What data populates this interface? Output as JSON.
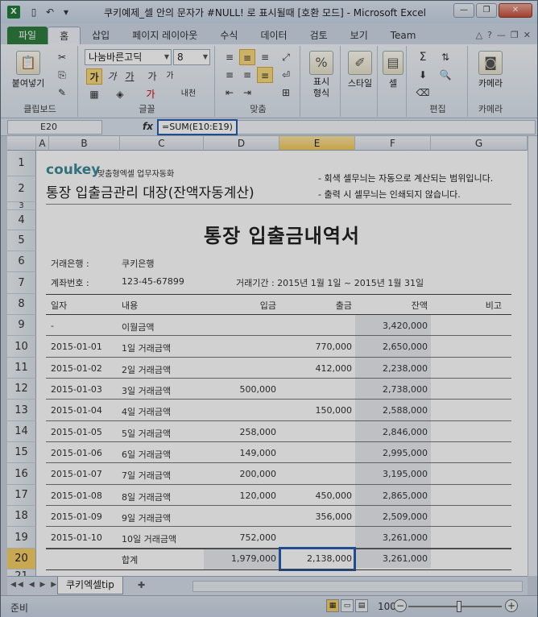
{
  "window": {
    "title": "쿠키예제_셀 안의 문자가 #NULL! 로 표시될때 [호환 모드] - Microsoft Excel",
    "app_icon": "X",
    "quick_access": [
      "save-icon",
      "undo-icon",
      "redo-icon"
    ],
    "buttons": [
      "minimize",
      "restore",
      "close"
    ],
    "button_glyphs": [
      "—",
      "❐",
      "✕"
    ]
  },
  "tabs": [
    "파일",
    "홈",
    "삽입",
    "페이지 레이아웃",
    "수식",
    "데이터",
    "검토",
    "보기",
    "Team"
  ],
  "ribbon": {
    "clipboard": {
      "paste": "붙여넣기",
      "label": "클립보드"
    },
    "font": {
      "name": "나눔바른고딕",
      "size": "8",
      "label": "글꼴",
      "bold": "가",
      "italic": "가",
      "underline": "가",
      "grow": "가",
      "shrink": "가",
      "phonetic": "내천"
    },
    "align": {
      "label": "맞춤"
    },
    "number": {
      "btn": "표시 형식",
      "symbol": "%"
    },
    "styles": {
      "btn": "스타일"
    },
    "cells": {
      "btn": "셀"
    },
    "edit": {
      "label": "편집",
      "sum": "Σ"
    },
    "camera": {
      "btn": "카메라",
      "label": "카메라"
    }
  },
  "formula_bar": {
    "name_box": "E20",
    "fx": "fx",
    "formula": "=SUM(E10:E19)"
  },
  "columns": [
    "A",
    "B",
    "C",
    "D",
    "E",
    "F",
    "G"
  ],
  "selected_column": "E",
  "rows": [
    "1",
    "2",
    "3",
    "4",
    "5",
    "6",
    "7",
    "8",
    "9",
    "10",
    "11",
    "12",
    "13",
    "14",
    "15",
    "16",
    "17",
    "18",
    "19",
    "20",
    "21"
  ],
  "selected_row": "20",
  "sheet": {
    "logo": "coukey",
    "logo_tagline": "맞춤형엑셀 업무자동화",
    "subtitle": "통장 입출금관리 대장(잔액자동계산)",
    "note1": "- 회색 셀무늬는 자동으로 계산되는 범위입니다.",
    "note2": "- 출력 시 셀무늬는 인쇄되지 않습니다.",
    "title": "통장 입출금내역서",
    "bank_label": "거래은행 :",
    "bank_value": "쿠키은행",
    "account_label": "계좌번호 :",
    "account_value": "123-45-67899",
    "period": "거래기간 : 2015년 1월 1일 ~ 2015년 1월 31일",
    "headers": [
      "일자",
      "내용",
      "입금",
      "출금",
      "잔액",
      "비고"
    ],
    "table_rows": [
      [
        "-",
        "이월금액",
        "",
        "",
        "3,420,000",
        ""
      ],
      [
        "2015-01-01",
        "1일 거래금액",
        "",
        "770,000",
        "2,650,000",
        ""
      ],
      [
        "2015-01-02",
        "2일 거래금액",
        "",
        "412,000",
        "2,238,000",
        ""
      ],
      [
        "2015-01-03",
        "3일 거래금액",
        "500,000",
        "",
        "2,738,000",
        ""
      ],
      [
        "2015-01-04",
        "4일 거래금액",
        "",
        "150,000",
        "2,588,000",
        ""
      ],
      [
        "2015-01-05",
        "5일 거래금액",
        "258,000",
        "",
        "2,846,000",
        ""
      ],
      [
        "2015-01-06",
        "6일 거래금액",
        "149,000",
        "",
        "2,995,000",
        ""
      ],
      [
        "2015-01-07",
        "7일 거래금액",
        "200,000",
        "",
        "3,195,000",
        ""
      ],
      [
        "2015-01-08",
        "8일 거래금액",
        "120,000",
        "450,000",
        "2,865,000",
        ""
      ],
      [
        "2015-01-09",
        "9일 거래금액",
        "",
        "356,000",
        "2,509,000",
        ""
      ],
      [
        "2015-01-10",
        "10일 거래금액",
        "752,000",
        "",
        "3,261,000",
        ""
      ]
    ],
    "total": {
      "label": "합계",
      "deposit": "1,979,000",
      "withdraw": "2,138,000",
      "balance": "3,261,000"
    }
  },
  "sheet_tabs": {
    "active": "쿠키엑셀tip",
    "nav": "◀◀ ◀ ▶ ▶▶"
  },
  "status": {
    "ready": "준비",
    "zoom": "100%"
  },
  "colors": {
    "accent": "#2a5db0",
    "file_tab": "#2e7d3e",
    "shade": "#e8ebef",
    "selection_header": "#f4cd63"
  }
}
